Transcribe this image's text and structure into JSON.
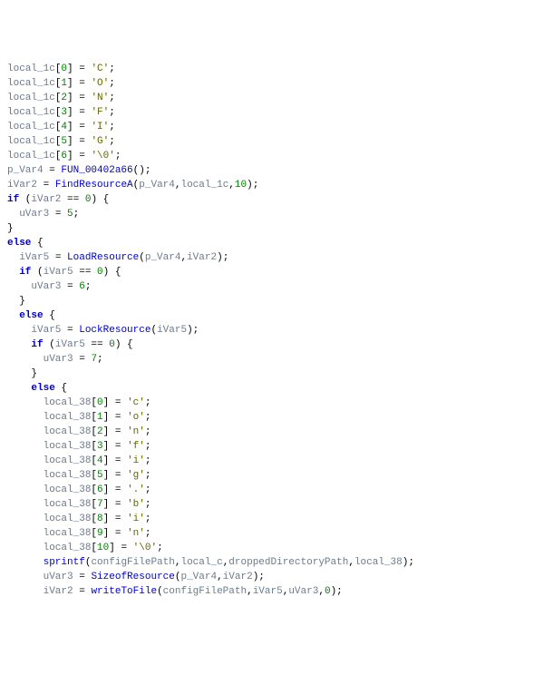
{
  "code": {
    "lines": [
      {
        "indent": 0,
        "tokens": [
          {
            "t": "var",
            "v": "local_1c"
          },
          {
            "t": "bracket",
            "v": "["
          },
          {
            "t": "num",
            "v": "0"
          },
          {
            "t": "bracket",
            "v": "]"
          },
          {
            "t": "op",
            "v": " = "
          },
          {
            "t": "char",
            "v": "'C'"
          },
          {
            "t": "punct",
            "v": ";"
          }
        ]
      },
      {
        "indent": 0,
        "tokens": [
          {
            "t": "var",
            "v": "local_1c"
          },
          {
            "t": "bracket",
            "v": "["
          },
          {
            "t": "num",
            "v": "1"
          },
          {
            "t": "bracket",
            "v": "]"
          },
          {
            "t": "op",
            "v": " = "
          },
          {
            "t": "char",
            "v": "'O'"
          },
          {
            "t": "punct",
            "v": ";"
          }
        ]
      },
      {
        "indent": 0,
        "tokens": [
          {
            "t": "var",
            "v": "local_1c"
          },
          {
            "t": "bracket",
            "v": "["
          },
          {
            "t": "num",
            "v": "2"
          },
          {
            "t": "bracket",
            "v": "]"
          },
          {
            "t": "op",
            "v": " = "
          },
          {
            "t": "char",
            "v": "'N'"
          },
          {
            "t": "punct",
            "v": ";"
          }
        ]
      },
      {
        "indent": 0,
        "tokens": [
          {
            "t": "var",
            "v": "local_1c"
          },
          {
            "t": "bracket",
            "v": "["
          },
          {
            "t": "num",
            "v": "3"
          },
          {
            "t": "bracket",
            "v": "]"
          },
          {
            "t": "op",
            "v": " = "
          },
          {
            "t": "char",
            "v": "'F'"
          },
          {
            "t": "punct",
            "v": ";"
          }
        ]
      },
      {
        "indent": 0,
        "tokens": [
          {
            "t": "var",
            "v": "local_1c"
          },
          {
            "t": "bracket",
            "v": "["
          },
          {
            "t": "num",
            "v": "4"
          },
          {
            "t": "bracket",
            "v": "]"
          },
          {
            "t": "op",
            "v": " = "
          },
          {
            "t": "char",
            "v": "'I'"
          },
          {
            "t": "punct",
            "v": ";"
          }
        ]
      },
      {
        "indent": 0,
        "tokens": [
          {
            "t": "var",
            "v": "local_1c"
          },
          {
            "t": "bracket",
            "v": "["
          },
          {
            "t": "num",
            "v": "5"
          },
          {
            "t": "bracket",
            "v": "]"
          },
          {
            "t": "op",
            "v": " = "
          },
          {
            "t": "char",
            "v": "'G'"
          },
          {
            "t": "punct",
            "v": ";"
          }
        ]
      },
      {
        "indent": 0,
        "tokens": [
          {
            "t": "var",
            "v": "local_1c"
          },
          {
            "t": "bracket",
            "v": "["
          },
          {
            "t": "num",
            "v": "6"
          },
          {
            "t": "bracket",
            "v": "]"
          },
          {
            "t": "op",
            "v": " = "
          },
          {
            "t": "char",
            "v": "'\\0'"
          },
          {
            "t": "punct",
            "v": ";"
          }
        ]
      },
      {
        "indent": 0,
        "tokens": [
          {
            "t": "var",
            "v": "p_Var4"
          },
          {
            "t": "op",
            "v": " = "
          },
          {
            "t": "func",
            "v": "FUN_00402a66"
          },
          {
            "t": "punct",
            "v": "();"
          }
        ]
      },
      {
        "indent": 0,
        "tokens": [
          {
            "t": "var",
            "v": "iVar2"
          },
          {
            "t": "op",
            "v": " = "
          },
          {
            "t": "func",
            "v": "FindResourceA"
          },
          {
            "t": "punct",
            "v": "("
          },
          {
            "t": "var",
            "v": "p_Var4"
          },
          {
            "t": "punct",
            "v": ","
          },
          {
            "t": "var",
            "v": "local_1c"
          },
          {
            "t": "punct",
            "v": ","
          },
          {
            "t": "num",
            "v": "10"
          },
          {
            "t": "punct",
            "v": ");"
          }
        ]
      },
      {
        "indent": 0,
        "tokens": [
          {
            "t": "kw",
            "v": "if"
          },
          {
            "t": "op",
            "v": " ("
          },
          {
            "t": "var",
            "v": "iVar2"
          },
          {
            "t": "op",
            "v": " == "
          },
          {
            "t": "num",
            "v": "0"
          },
          {
            "t": "punct",
            "v": ") {"
          }
        ]
      },
      {
        "indent": 1,
        "tokens": [
          {
            "t": "var",
            "v": "uVar3"
          },
          {
            "t": "op",
            "v": " = "
          },
          {
            "t": "num",
            "v": "5"
          },
          {
            "t": "punct",
            "v": ";"
          }
        ]
      },
      {
        "indent": 0,
        "tokens": [
          {
            "t": "punct",
            "v": "}"
          }
        ]
      },
      {
        "indent": 0,
        "tokens": [
          {
            "t": "kw",
            "v": "else"
          },
          {
            "t": "punct",
            "v": " {"
          }
        ]
      },
      {
        "indent": 1,
        "tokens": [
          {
            "t": "var",
            "v": "iVar5"
          },
          {
            "t": "op",
            "v": " = "
          },
          {
            "t": "func",
            "v": "LoadResource"
          },
          {
            "t": "punct",
            "v": "("
          },
          {
            "t": "var",
            "v": "p_Var4"
          },
          {
            "t": "punct",
            "v": ","
          },
          {
            "t": "var",
            "v": "iVar2"
          },
          {
            "t": "punct",
            "v": ");"
          }
        ]
      },
      {
        "indent": 1,
        "tokens": [
          {
            "t": "kw",
            "v": "if"
          },
          {
            "t": "op",
            "v": " ("
          },
          {
            "t": "var",
            "v": "iVar5"
          },
          {
            "t": "op",
            "v": " == "
          },
          {
            "t": "num",
            "v": "0"
          },
          {
            "t": "punct",
            "v": ") {"
          }
        ]
      },
      {
        "indent": 2,
        "tokens": [
          {
            "t": "var",
            "v": "uVar3"
          },
          {
            "t": "op",
            "v": " = "
          },
          {
            "t": "num",
            "v": "6"
          },
          {
            "t": "punct",
            "v": ";"
          }
        ]
      },
      {
        "indent": 1,
        "tokens": [
          {
            "t": "punct",
            "v": "}"
          }
        ]
      },
      {
        "indent": 1,
        "tokens": [
          {
            "t": "kw",
            "v": "else"
          },
          {
            "t": "punct",
            "v": " {"
          }
        ]
      },
      {
        "indent": 2,
        "tokens": [
          {
            "t": "var",
            "v": "iVar5"
          },
          {
            "t": "op",
            "v": " = "
          },
          {
            "t": "func",
            "v": "LockResource"
          },
          {
            "t": "punct",
            "v": "("
          },
          {
            "t": "var",
            "v": "iVar5"
          },
          {
            "t": "punct",
            "v": ");"
          }
        ]
      },
      {
        "indent": 2,
        "tokens": [
          {
            "t": "kw",
            "v": "if"
          },
          {
            "t": "op",
            "v": " ("
          },
          {
            "t": "var",
            "v": "iVar5"
          },
          {
            "t": "op",
            "v": " == "
          },
          {
            "t": "num",
            "v": "0"
          },
          {
            "t": "punct",
            "v": ") {"
          }
        ]
      },
      {
        "indent": 3,
        "tokens": [
          {
            "t": "var",
            "v": "uVar3"
          },
          {
            "t": "op",
            "v": " = "
          },
          {
            "t": "num",
            "v": "7"
          },
          {
            "t": "punct",
            "v": ";"
          }
        ]
      },
      {
        "indent": 2,
        "tokens": [
          {
            "t": "punct",
            "v": "}"
          }
        ]
      },
      {
        "indent": 2,
        "tokens": [
          {
            "t": "kw",
            "v": "else"
          },
          {
            "t": "punct",
            "v": " {"
          }
        ]
      },
      {
        "indent": 3,
        "tokens": [
          {
            "t": "var",
            "v": "local_38"
          },
          {
            "t": "bracket",
            "v": "["
          },
          {
            "t": "num",
            "v": "0"
          },
          {
            "t": "bracket",
            "v": "]"
          },
          {
            "t": "op",
            "v": " = "
          },
          {
            "t": "char",
            "v": "'c'"
          },
          {
            "t": "punct",
            "v": ";"
          }
        ]
      },
      {
        "indent": 3,
        "tokens": [
          {
            "t": "var",
            "v": "local_38"
          },
          {
            "t": "bracket",
            "v": "["
          },
          {
            "t": "num",
            "v": "1"
          },
          {
            "t": "bracket",
            "v": "]"
          },
          {
            "t": "op",
            "v": " = "
          },
          {
            "t": "char",
            "v": "'o'"
          },
          {
            "t": "punct",
            "v": ";"
          }
        ]
      },
      {
        "indent": 3,
        "tokens": [
          {
            "t": "var",
            "v": "local_38"
          },
          {
            "t": "bracket",
            "v": "["
          },
          {
            "t": "num",
            "v": "2"
          },
          {
            "t": "bracket",
            "v": "]"
          },
          {
            "t": "op",
            "v": " = "
          },
          {
            "t": "char",
            "v": "'n'"
          },
          {
            "t": "punct",
            "v": ";"
          }
        ]
      },
      {
        "indent": 3,
        "tokens": [
          {
            "t": "var",
            "v": "local_38"
          },
          {
            "t": "bracket",
            "v": "["
          },
          {
            "t": "num",
            "v": "3"
          },
          {
            "t": "bracket",
            "v": "]"
          },
          {
            "t": "op",
            "v": " = "
          },
          {
            "t": "char",
            "v": "'f'"
          },
          {
            "t": "punct",
            "v": ";"
          }
        ]
      },
      {
        "indent": 3,
        "tokens": [
          {
            "t": "var",
            "v": "local_38"
          },
          {
            "t": "bracket",
            "v": "["
          },
          {
            "t": "num",
            "v": "4"
          },
          {
            "t": "bracket",
            "v": "]"
          },
          {
            "t": "op",
            "v": " = "
          },
          {
            "t": "char",
            "v": "'i'"
          },
          {
            "t": "punct",
            "v": ";"
          }
        ]
      },
      {
        "indent": 3,
        "tokens": [
          {
            "t": "var",
            "v": "local_38"
          },
          {
            "t": "bracket",
            "v": "["
          },
          {
            "t": "num",
            "v": "5"
          },
          {
            "t": "bracket",
            "v": "]"
          },
          {
            "t": "op",
            "v": " = "
          },
          {
            "t": "char",
            "v": "'g'"
          },
          {
            "t": "punct",
            "v": ";"
          }
        ]
      },
      {
        "indent": 3,
        "tokens": [
          {
            "t": "var",
            "v": "local_38"
          },
          {
            "t": "bracket",
            "v": "["
          },
          {
            "t": "num",
            "v": "6"
          },
          {
            "t": "bracket",
            "v": "]"
          },
          {
            "t": "op",
            "v": " = "
          },
          {
            "t": "char",
            "v": "'.'"
          },
          {
            "t": "punct",
            "v": ";"
          }
        ]
      },
      {
        "indent": 3,
        "tokens": [
          {
            "t": "var",
            "v": "local_38"
          },
          {
            "t": "bracket",
            "v": "["
          },
          {
            "t": "num",
            "v": "7"
          },
          {
            "t": "bracket",
            "v": "]"
          },
          {
            "t": "op",
            "v": " = "
          },
          {
            "t": "char",
            "v": "'b'"
          },
          {
            "t": "punct",
            "v": ";"
          }
        ]
      },
      {
        "indent": 3,
        "tokens": [
          {
            "t": "var",
            "v": "local_38"
          },
          {
            "t": "bracket",
            "v": "["
          },
          {
            "t": "num",
            "v": "8"
          },
          {
            "t": "bracket",
            "v": "]"
          },
          {
            "t": "op",
            "v": " = "
          },
          {
            "t": "char",
            "v": "'i'"
          },
          {
            "t": "punct",
            "v": ";"
          }
        ]
      },
      {
        "indent": 3,
        "tokens": [
          {
            "t": "var",
            "v": "local_38"
          },
          {
            "t": "bracket",
            "v": "["
          },
          {
            "t": "num",
            "v": "9"
          },
          {
            "t": "bracket",
            "v": "]"
          },
          {
            "t": "op",
            "v": " = "
          },
          {
            "t": "char",
            "v": "'n'"
          },
          {
            "t": "punct",
            "v": ";"
          }
        ]
      },
      {
        "indent": 3,
        "tokens": [
          {
            "t": "var",
            "v": "local_38"
          },
          {
            "t": "bracket",
            "v": "["
          },
          {
            "t": "num",
            "v": "10"
          },
          {
            "t": "bracket",
            "v": "]"
          },
          {
            "t": "op",
            "v": " = "
          },
          {
            "t": "char",
            "v": "'\\0'"
          },
          {
            "t": "punct",
            "v": ";"
          }
        ]
      },
      {
        "indent": 3,
        "tokens": [
          {
            "t": "func",
            "v": "sprintf"
          },
          {
            "t": "punct",
            "v": "("
          },
          {
            "t": "var",
            "v": "configFilePath"
          },
          {
            "t": "punct",
            "v": ","
          },
          {
            "t": "var",
            "v": "local_c"
          },
          {
            "t": "punct",
            "v": ","
          },
          {
            "t": "var",
            "v": "droppedDirectoryPath"
          },
          {
            "t": "punct",
            "v": ","
          },
          {
            "t": "var",
            "v": "local_38"
          },
          {
            "t": "punct",
            "v": ");"
          }
        ]
      },
      {
        "indent": 3,
        "tokens": [
          {
            "t": "var",
            "v": "uVar3"
          },
          {
            "t": "op",
            "v": " = "
          },
          {
            "t": "func",
            "v": "SizeofResource"
          },
          {
            "t": "punct",
            "v": "("
          },
          {
            "t": "var",
            "v": "p_Var4"
          },
          {
            "t": "punct",
            "v": ","
          },
          {
            "t": "var",
            "v": "iVar2"
          },
          {
            "t": "punct",
            "v": ");"
          }
        ]
      },
      {
        "indent": 3,
        "tokens": [
          {
            "t": "var",
            "v": "iVar2"
          },
          {
            "t": "op",
            "v": " = "
          },
          {
            "t": "func",
            "v": "writeToFile"
          },
          {
            "t": "punct",
            "v": "("
          },
          {
            "t": "var",
            "v": "configFilePath"
          },
          {
            "t": "punct",
            "v": ","
          },
          {
            "t": "var",
            "v": "iVar5"
          },
          {
            "t": "punct",
            "v": ","
          },
          {
            "t": "var",
            "v": "uVar3"
          },
          {
            "t": "punct",
            "v": ","
          },
          {
            "t": "num",
            "v": "0"
          },
          {
            "t": "punct",
            "v": ");"
          }
        ]
      }
    ],
    "indent_unit": "  "
  }
}
